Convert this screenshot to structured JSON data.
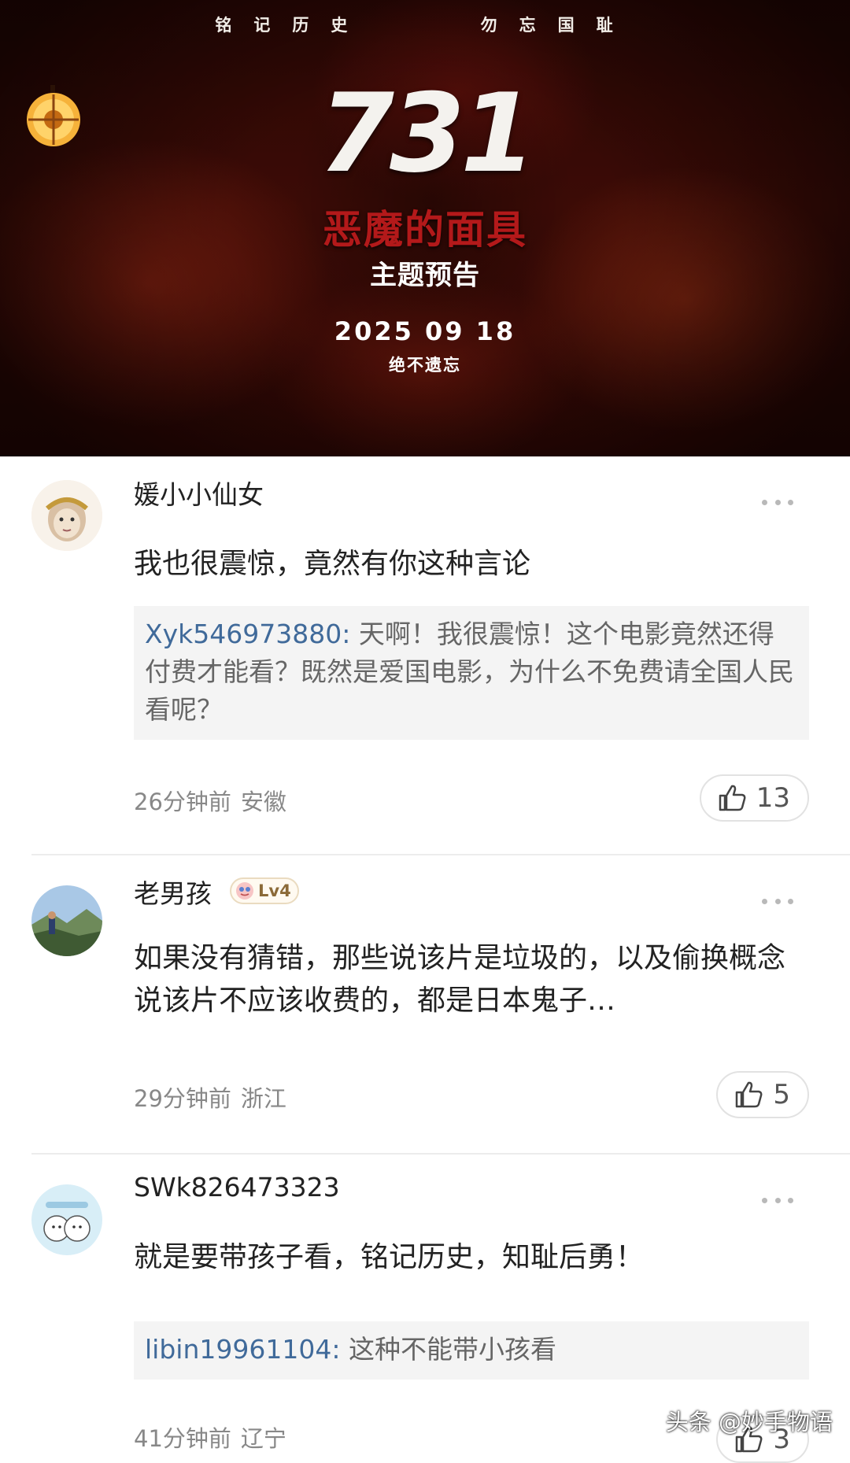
{
  "poster": {
    "tagline": "铭记历史    勿忘国耻",
    "number": "731",
    "subtitle": "恶魔的面具",
    "trailer_tag": "主题预告",
    "date": "2025 09 18",
    "slogan": "绝不遗忘"
  },
  "comments": [
    {
      "username": "媛小小仙女",
      "text": "我也很震惊，竟然有你这种言论",
      "quote_user": "Xyk546973880:",
      "quote_text": "天啊！我很震惊！这个电影竟然还得付费才能看？既然是爱国电影，为什么不免费请全国人民看呢？",
      "time": "26分钟前",
      "region": "安徽",
      "likes": "13"
    },
    {
      "username": "老男孩",
      "badge": "Lv4",
      "text": "如果没有猜错，那些说该片是垃圾的，以及偷换概念说该片不应该收费的，都是日本鬼子…",
      "time": "29分钟前",
      "region": "浙江",
      "likes": "5"
    },
    {
      "username": "SWk826473323",
      "text": "就是要带孩子看，铭记历史，知耻后勇！",
      "quote_user": "libin19961104:",
      "quote_text": "这种不能带小孩看",
      "time": "41分钟前",
      "region": "辽宁",
      "likes": "3"
    }
  ],
  "watermark": "头条 @妙手物语"
}
